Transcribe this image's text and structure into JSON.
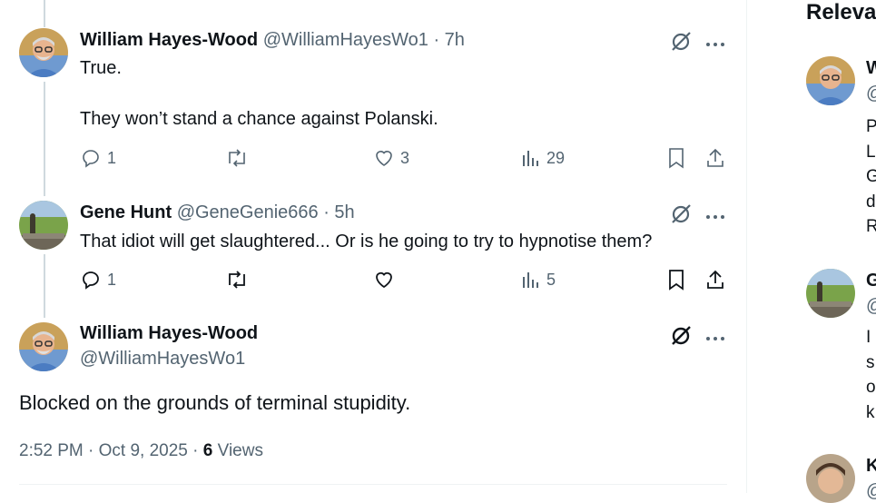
{
  "tweets": [
    {
      "name": "William Hayes-Wood",
      "handle": "@WilliamHayesWo1",
      "time": "· 7h",
      "text": "True.\n\nThey won’t stand a chance against Polanski.",
      "reply_count": "1",
      "retweet_count": "",
      "like_count": "3",
      "view_count": "29"
    },
    {
      "name": "Gene Hunt",
      "handle": "@GeneGenie666",
      "time": "· 5h",
      "text": "That idiot will get slaughtered... Or is he going to try to hypnotise them?",
      "reply_count": "1",
      "retweet_count": "",
      "like_count": "",
      "view_count": "5"
    }
  ],
  "main_tweet": {
    "name": "William Hayes-Wood",
    "handle": "@WilliamHayesWo1",
    "text": "Blocked on the grounds of terminal stupidity.",
    "timestamp": "2:52 PM · Oct 9, 2025 ·",
    "views_count": "6",
    "views_label": "Views"
  },
  "sidebar": {
    "title": "Releva",
    "people": [
      {
        "name": "W",
        "handle": "@",
        "bio": "P\nL\nG\nd\nR"
      },
      {
        "name": "G",
        "handle": "@",
        "bio": "I\ns\no\nk"
      },
      {
        "name": "K",
        "handle": "@",
        "bio": ""
      }
    ]
  },
  "colors": {
    "text": "#0f1419",
    "secondary": "#536471",
    "line": "#cfd9de",
    "divider": "#eff3f4"
  }
}
